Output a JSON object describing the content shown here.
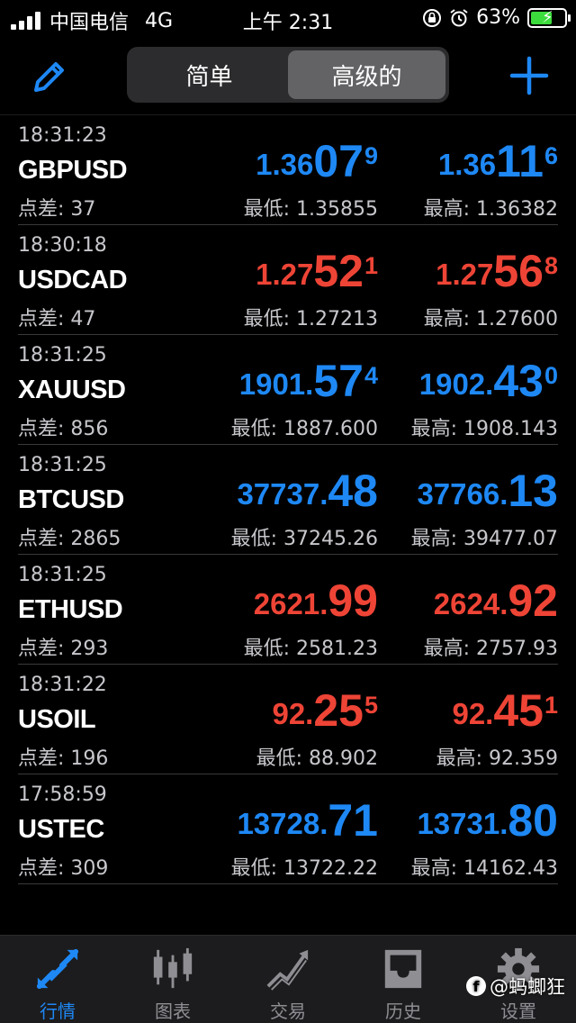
{
  "status_bar": {
    "carrier": "中国电信",
    "network": "4G",
    "time": "上午 2:31",
    "battery_percent": "63%",
    "battery_level": 0.63
  },
  "nav": {
    "segments": [
      "简单",
      "高级的"
    ],
    "active_segment": 1
  },
  "quotes": [
    {
      "time": "18:31:23",
      "symbol": "GBPUSD",
      "spread": "点差: 37",
      "trend": "up",
      "bid": {
        "small": "1.36",
        "big": "07",
        "sup": "9"
      },
      "ask": {
        "small": "1.36",
        "big": "11",
        "sup": "6"
      },
      "low": "最低: 1.35855",
      "high": "最高: 1.36382"
    },
    {
      "time": "18:30:18",
      "symbol": "USDCAD",
      "spread": "点差: 47",
      "trend": "down",
      "bid": {
        "small": "1.27",
        "big": "52",
        "sup": "1"
      },
      "ask": {
        "small": "1.27",
        "big": "56",
        "sup": "8"
      },
      "low": "最低: 1.27213",
      "high": "最高: 1.27600"
    },
    {
      "time": "18:31:25",
      "symbol": "XAUUSD",
      "spread": "点差: 856",
      "trend": "up",
      "bid": {
        "small": "1901.",
        "big": "57",
        "sup": "4"
      },
      "ask": {
        "small": "1902.",
        "big": "43",
        "sup": "0"
      },
      "low": "最低: 1887.600",
      "high": "最高: 1908.143"
    },
    {
      "time": "18:31:25",
      "symbol": "BTCUSD",
      "spread": "点差: 2865",
      "trend": "up",
      "bid": {
        "small": "37737.",
        "big": "48",
        "sup": ""
      },
      "ask": {
        "small": "37766.",
        "big": "13",
        "sup": ""
      },
      "low": "最低: 37245.26",
      "high": "最高: 39477.07"
    },
    {
      "time": "18:31:25",
      "symbol": "ETHUSD",
      "spread": "点差: 293",
      "trend": "down",
      "bid": {
        "small": "2621.",
        "big": "99",
        "sup": ""
      },
      "ask": {
        "small": "2624.",
        "big": "92",
        "sup": ""
      },
      "low": "最低: 2581.23",
      "high": "最高: 2757.93"
    },
    {
      "time": "18:31:22",
      "symbol": "USOIL",
      "spread": "点差: 196",
      "trend": "down",
      "bid": {
        "small": "92.",
        "big": "25",
        "sup": "5"
      },
      "ask": {
        "small": "92.",
        "big": "45",
        "sup": "1"
      },
      "low": "最低: 88.902",
      "high": "最高: 92.359"
    },
    {
      "time": "17:58:59",
      "symbol": "USTEC",
      "spread": "点差: 309",
      "trend": "up",
      "bid": {
        "small": "13728.",
        "big": "71",
        "sup": ""
      },
      "ask": {
        "small": "13731.",
        "big": "80",
        "sup": ""
      },
      "low": "最低: 13722.22",
      "high": "最高: 14162.43"
    }
  ],
  "tabs": [
    {
      "label": "行情",
      "icon": "quotes-arrows-icon",
      "active": true
    },
    {
      "label": "图表",
      "icon": "candlestick-chart-icon",
      "active": false
    },
    {
      "label": "交易",
      "icon": "trade-trend-icon",
      "active": false
    },
    {
      "label": "历史",
      "icon": "history-inbox-icon",
      "active": false
    },
    {
      "label": "设置",
      "icon": "gear-icon",
      "active": false
    }
  ],
  "watermark": "@蚂蝍狂",
  "colors": {
    "up": "#1e88f5",
    "down": "#ee4436",
    "accent": "#1e88f5"
  }
}
